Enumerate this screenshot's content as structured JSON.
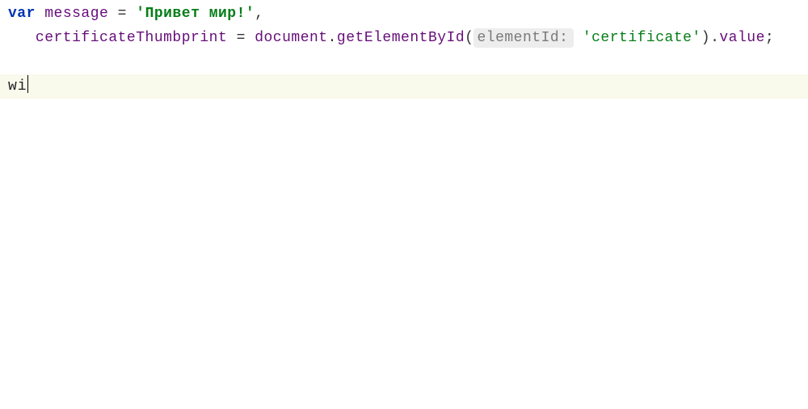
{
  "code": {
    "line1": {
      "var_kw": "var",
      "sp1": " ",
      "msg_ident": "message",
      "sp2": " ",
      "eq1": "=",
      "sp3": " ",
      "str1": "'Привет мир!'",
      "comma": ","
    },
    "line2": {
      "indent": "   ",
      "cert_ident": "certificateThumbprint",
      "sp1": " ",
      "eq": "=",
      "sp2": " ",
      "doc": "document",
      "dot1": ".",
      "getel": "getElementById",
      "lparen": "(",
      "hint": "elementId:",
      "sp3": " ",
      "str": "'certificate'",
      "rparen": ")",
      "dot2": ".",
      "value": "value",
      "semi": ";"
    },
    "line3": "",
    "line4": {
      "typed": "wi"
    }
  }
}
